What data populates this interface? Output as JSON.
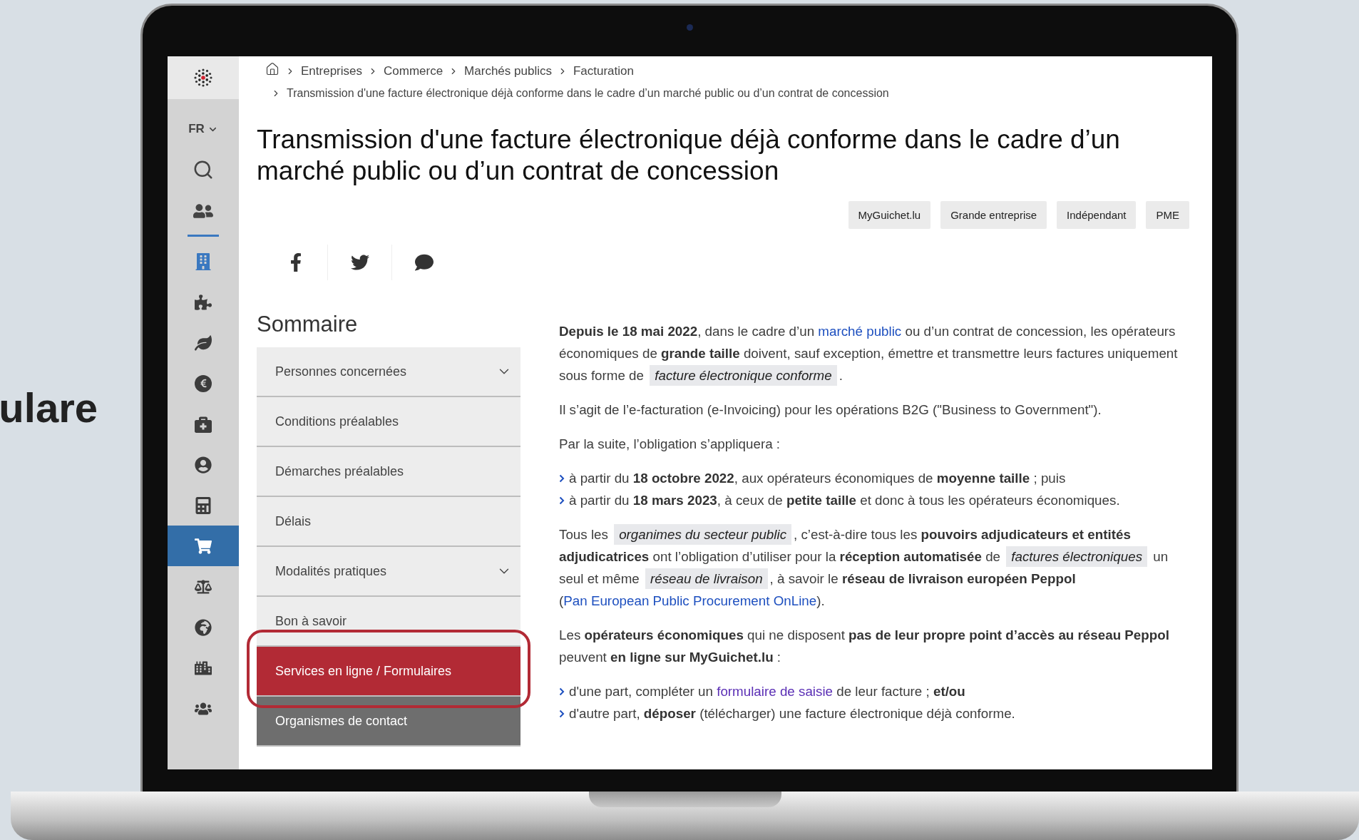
{
  "backdrop_text": "ulare",
  "sidebar": {
    "language": "FR",
    "nav": [
      {
        "selected": false,
        "highlighted": true
      },
      {
        "selected": false,
        "highlighted": false
      },
      {
        "selected": false,
        "highlighted": false
      },
      {
        "selected": false,
        "highlighted": false
      },
      {
        "selected": false,
        "highlighted": false
      },
      {
        "selected": false,
        "highlighted": false
      },
      {
        "selected": false,
        "highlighted": false
      },
      {
        "selected": true,
        "highlighted": false
      },
      {
        "selected": false,
        "highlighted": false
      },
      {
        "selected": false,
        "highlighted": false
      },
      {
        "selected": false,
        "highlighted": false
      },
      {
        "selected": false,
        "highlighted": false
      }
    ]
  },
  "breadcrumb": [
    "Entreprises",
    "Commerce",
    "Marchés publics",
    "Facturation",
    "Transmission d'une facture électronique déjà conforme dans le cadre d’un marché public ou d’un contrat de concession"
  ],
  "title": "Transmission d'une facture électronique déjà conforme dans le cadre d’un marché public ou d’un contrat de concession",
  "tags": [
    "MyGuichet.lu",
    "Grande entreprise",
    "Indépendant",
    "PME"
  ],
  "summary": {
    "heading": "Sommaire",
    "items": [
      {
        "label": "Personnes concernées",
        "expandable": true,
        "selected": false,
        "hovered": false,
        "circled": false
      },
      {
        "label": "Conditions préalables",
        "expandable": false,
        "selected": false,
        "hovered": false,
        "circled": false
      },
      {
        "label": "Démarches préalables",
        "expandable": false,
        "selected": false,
        "hovered": false,
        "circled": false
      },
      {
        "label": "Délais",
        "expandable": false,
        "selected": false,
        "hovered": false,
        "circled": false
      },
      {
        "label": "Modalités pratiques",
        "expandable": true,
        "selected": false,
        "hovered": false,
        "circled": false
      },
      {
        "label": "Bon à savoir",
        "expandable": false,
        "selected": false,
        "hovered": false,
        "circled": false
      },
      {
        "label": "Services en ligne / Formulaires",
        "expandable": false,
        "selected": true,
        "hovered": false,
        "circled": true
      },
      {
        "label": "Organismes de contact",
        "expandable": false,
        "selected": false,
        "hovered": true,
        "circled": false
      }
    ]
  },
  "body": [
    {
      "kind": "paragraph",
      "parts": [
        {
          "kind": "text",
          "text": "**Depuis le 18 mai 2022**, dans le cadre d’un "
        },
        {
          "kind": "link",
          "text": "marché public",
          "visited": false
        },
        {
          "kind": "text",
          "text": " ou d’un contrat de concession, les opérateurs économiques de **grande taille** doivent, sauf exception, émettre et transmettre leurs factures uniquement sous forme de "
        },
        {
          "kind": "term",
          "text": "facture électronique conforme"
        },
        {
          "kind": "text",
          "text": "."
        }
      ]
    },
    {
      "kind": "paragraph",
      "parts": [
        {
          "kind": "text",
          "text": "Il s’agit de l’e-facturation (e-Invoicing) pour les opérations B2G (\"Business to Government\")."
        }
      ]
    },
    {
      "kind": "paragraph",
      "parts": [
        {
          "kind": "text",
          "text": "Par la suite, l’obligation s’appliquera :"
        }
      ]
    },
    {
      "kind": "list",
      "items": [
        {
          "parts": [
            {
              "kind": "text",
              "text": "à partir du **18 octobre 2022**, aux opérateurs économiques de **moyenne taille** ; puis"
            }
          ]
        },
        {
          "parts": [
            {
              "kind": "text",
              "text": "à partir du **18 mars 2023**, à ceux de **petite taille** et donc à tous les opérateurs économiques."
            }
          ]
        }
      ]
    },
    {
      "kind": "paragraph",
      "parts": [
        {
          "kind": "text",
          "text": "Tous les "
        },
        {
          "kind": "term",
          "text": "organimes du secteur public"
        },
        {
          "kind": "text",
          "text": ", c’est-à-dire tous les **pouvoirs adjudicateurs et entités adjudicatrices** ont l’obligation d’utiliser pour la **réception automatisée** de "
        },
        {
          "kind": "term",
          "text": "factures électroniques"
        },
        {
          "kind": "text",
          "text": " un seul et même "
        },
        {
          "kind": "term",
          "text": "réseau de livraison"
        },
        {
          "kind": "text",
          "text": ", à savoir le **réseau de livraison européen Peppol** ("
        },
        {
          "kind": "link",
          "text": "Pan European Public Procurement OnLine",
          "visited": false
        },
        {
          "kind": "text",
          "text": ")."
        }
      ]
    },
    {
      "kind": "paragraph",
      "parts": [
        {
          "kind": "text",
          "text": "Les **opérateurs économiques** qui ne disposent **pas de leur propre point d’accès au réseau Peppol** peuvent **en ligne sur MyGuichet.lu** :"
        }
      ]
    },
    {
      "kind": "list",
      "items": [
        {
          "parts": [
            {
              "kind": "text",
              "text": "d'une part, compléter un "
            },
            {
              "kind": "link",
              "text": "formulaire de saisie",
              "visited": true
            },
            {
              "kind": "text",
              "text": " de leur facture ; **et/ou**"
            }
          ]
        },
        {
          "parts": [
            {
              "kind": "text",
              "text": "d'autre part, **déposer** (télécharger) une facture électronique déjà conforme."
            }
          ]
        }
      ]
    }
  ]
}
